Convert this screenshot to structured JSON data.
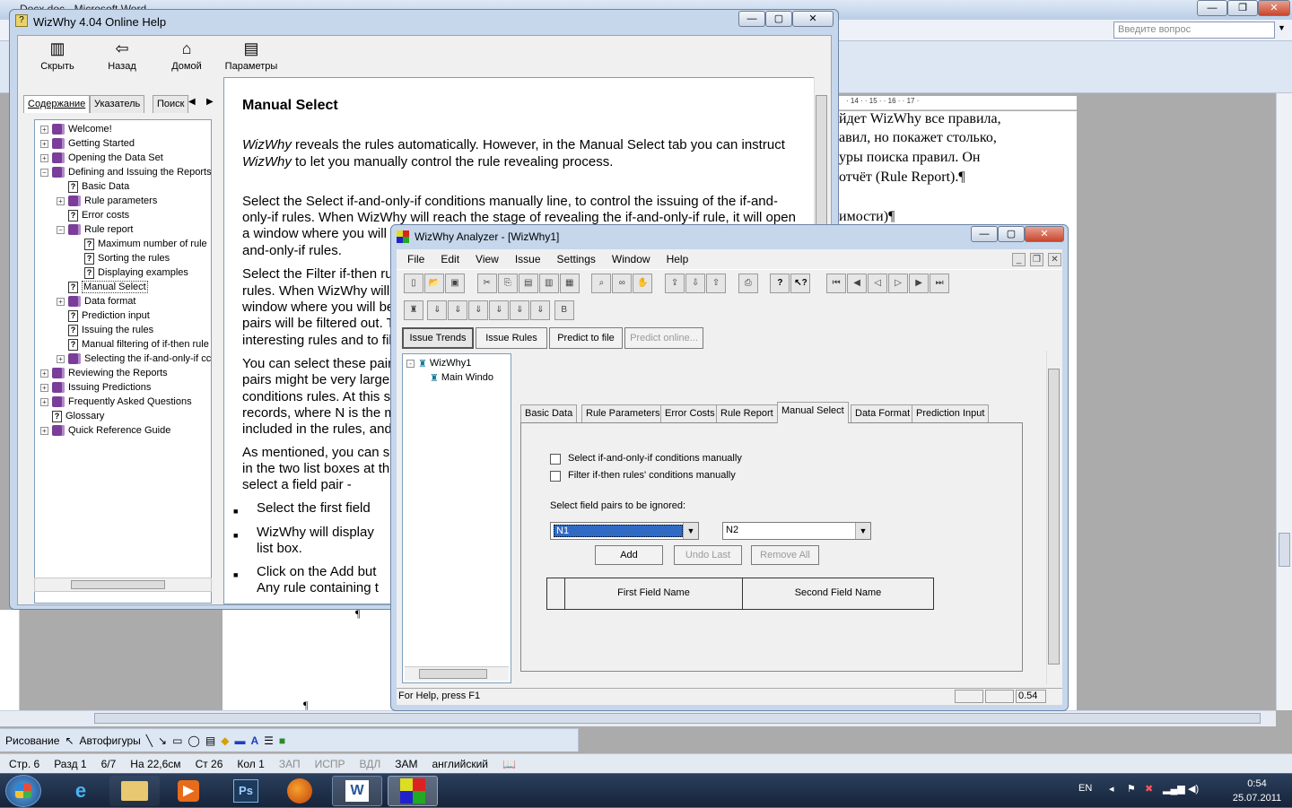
{
  "word": {
    "title": "Docx.doc - Microsoft Word",
    "ask_placeholder": "Введите вопрос",
    "ruler_text": "· 14 · · 15 · · 16 · · 17 ·",
    "doc_lines": [
      "йдет WizWhy все правила,",
      "авил, но покажет столько,",
      "уры поиска правил. Он",
      "отчёт (Rule Report).¶",
      "имости)¶"
    ],
    "pilcrow": "¶",
    "draw_label": "Рисование",
    "autoshapes_label": "Автофигуры",
    "status": {
      "page": "Стр. 6",
      "section": "Разд 1",
      "pages": "6/7",
      "at": "На 22,6см",
      "line": "Ст 26",
      "col": "Кол 1",
      "rec": "ЗАП",
      "trk": "ИСПР",
      "ext": "ВДЛ",
      "ovr": "ЗАМ",
      "lang": "английский"
    }
  },
  "help": {
    "title": "WizWhy 4.04 Online Help",
    "toolbar": [
      "Скрыть",
      "Назад",
      "Домой",
      "Параметры"
    ],
    "tabs": [
      "Содержание",
      "Указатель",
      "Поиск"
    ],
    "tree": [
      {
        "label": "Welcome!",
        "kind": "book",
        "level": 0,
        "exp": "+"
      },
      {
        "label": "Getting Started",
        "kind": "book",
        "level": 0,
        "exp": "+"
      },
      {
        "label": "Opening the Data Set",
        "kind": "book",
        "level": 0,
        "exp": "+"
      },
      {
        "label": "Defining and Issuing the Reports",
        "kind": "book",
        "level": 0,
        "exp": "-"
      },
      {
        "label": "Basic Data",
        "kind": "page",
        "level": 1,
        "exp": ""
      },
      {
        "label": "Rule parameters",
        "kind": "book",
        "level": 1,
        "exp": "+"
      },
      {
        "label": "Error costs",
        "kind": "page",
        "level": 1,
        "exp": ""
      },
      {
        "label": "Rule report",
        "kind": "openbook",
        "level": 1,
        "exp": "-"
      },
      {
        "label": "Maximum number of rule",
        "kind": "page",
        "level": 2,
        "exp": ""
      },
      {
        "label": "Sorting the rules",
        "kind": "page",
        "level": 2,
        "exp": ""
      },
      {
        "label": "Displaying examples",
        "kind": "page",
        "level": 2,
        "exp": ""
      },
      {
        "label": "Manual Select",
        "kind": "page",
        "level": 1,
        "exp": ""
      },
      {
        "label": "Data format",
        "kind": "book",
        "level": 1,
        "exp": "+"
      },
      {
        "label": "Prediction input",
        "kind": "page",
        "level": 1,
        "exp": ""
      },
      {
        "label": "Issuing the rules",
        "kind": "page",
        "level": 1,
        "exp": ""
      },
      {
        "label": "Manual filtering of if-then rule",
        "kind": "page",
        "level": 1,
        "exp": ""
      },
      {
        "label": "Selecting the if-and-only-if cc",
        "kind": "book",
        "level": 1,
        "exp": "+"
      },
      {
        "label": "Reviewing the Reports",
        "kind": "book",
        "level": 0,
        "exp": "+"
      },
      {
        "label": "Issuing Predictions",
        "kind": "book",
        "level": 0,
        "exp": "+"
      },
      {
        "label": "Frequently Asked Questions",
        "kind": "book",
        "level": 0,
        "exp": "+"
      },
      {
        "label": "Glossary",
        "kind": "page",
        "level": 0,
        "exp": ""
      },
      {
        "label": "Quick Reference Guide",
        "kind": "book",
        "level": 0,
        "exp": "+"
      }
    ],
    "heading": "Manual Select",
    "paragraphs": [
      [
        "WizWhy",
        " reveals the rules automatically. However, in the Manual Select tab you can instruct"
      ],
      [
        "WizWhy",
        " to let you manually control the rule revealing process."
      ],
      [
        "",
        "Select the Select if-and-only-if conditions manually line, to control the issuing of the if-and-"
      ],
      [
        "",
        "only-if rules. When WizWhy will reach the stage of revealing the if-and-only-if rule, it will open"
      ],
      [
        "",
        "a window where you will b"
      ],
      [
        "",
        "and-only-if rules."
      ],
      [
        "",
        "Select the Filter if-then rul"
      ],
      [
        "",
        "rules. When WizWhy will"
      ],
      [
        "",
        "window where you will be"
      ],
      [
        "",
        "pairs will be filtered out. T"
      ],
      [
        "",
        "interesting rules and to filt"
      ],
      [
        "",
        "You can select these pair"
      ],
      [
        "",
        "pairs might be very large,"
      ],
      [
        "",
        "conditions rules. At this st"
      ],
      [
        "",
        "records, where N is the m"
      ],
      [
        "",
        "included in the rules, and"
      ],
      [
        "",
        "As mentioned, you can se"
      ],
      [
        "",
        "in the two list boxes at the"
      ],
      [
        "",
        "select a field pair -"
      ]
    ],
    "bullets": [
      "Select the first field",
      "WizWhy will display",
      "list box.",
      "Click on the Add but",
      "Any rule containing t"
    ]
  },
  "analyzer": {
    "title": "WizWhy Analyzer - [WizWhy1]",
    "menu": [
      "File",
      "Edit",
      "View",
      "Issue",
      "Settings",
      "Window",
      "Help"
    ],
    "mode_buttons": [
      "Issue Trends",
      "Issue Rules",
      "Predict to file",
      "Predict online..."
    ],
    "tree": [
      "WizWhy1",
      "Main Windo"
    ],
    "tabs": [
      "Basic Data",
      "Rule Parameters",
      "Error Costs",
      "Rule Report",
      "Manual Select",
      "Data Format",
      "Prediction Input"
    ],
    "active_tab": "Manual Select",
    "checkbox1": "Select if-and-only-if conditions manually",
    "checkbox2": "Filter if-then rules' conditions manually",
    "pairs_label": "Select field pairs to be ignored:",
    "combo1": "N1",
    "combo2": "N2",
    "btn_add": "Add",
    "btn_undo": "Undo Last",
    "btn_remove": "Remove All",
    "col1": "First Field Name",
    "col2": "Second Field Name",
    "status_help": "For Help, press F1",
    "status_val": "0.54",
    "toolbar_b": "B"
  },
  "taskbar": {
    "lang": "EN",
    "time": "0:54",
    "date": "25.07.2011"
  },
  "colors": {
    "accent": "#316ac5",
    "book": "#7a3d99",
    "taskbar": "#1c2c45"
  }
}
